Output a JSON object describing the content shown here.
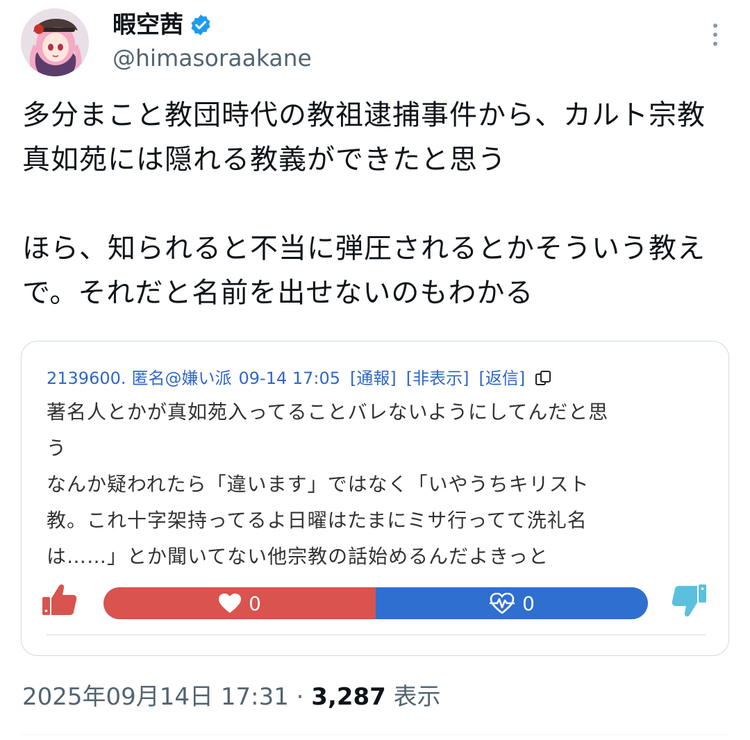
{
  "author": {
    "display_name": "暇空茜",
    "handle": "@himasoraakane",
    "verified_icon": "verified-badge-icon",
    "verified_color": "#1d9bf0"
  },
  "tweet": {
    "paragraphs": [
      "多分まこと教団時代の教祖逮捕事件から、カルト宗教真如苑には隠れる教義ができたと思う",
      "ほら、知られると不当に弾圧されるとかそういう教えで。それだと名前を出せないのもわかる"
    ]
  },
  "quoted_post": {
    "post_number": "2139600.",
    "author": "匿名@嫌い派",
    "datetime": "09-14 17:05",
    "actions": [
      "[通報]",
      "[非表示]",
      "[返信]"
    ],
    "lines": [
      "著名人とかが真如苑入ってることバレないようにしてんだと思",
      "う",
      "なんか疑われたら「違います」ではなく「いやうちキリスト",
      "教。これ十字架持ってるよ日曜はたまにミサ行ってて洗礼名",
      "は……」とか聞いてない他宗教の話始めるんだよきっと"
    ],
    "good_count": "0",
    "bad_count": "0",
    "good_color": "#d9534f",
    "bad_color": "#2f6fcf",
    "link_color": "#2f67c8"
  },
  "footer": {
    "timestamp": "2025年09月14日 17:31",
    "separator": " · ",
    "views": "3,287",
    "views_label": " 表示"
  }
}
